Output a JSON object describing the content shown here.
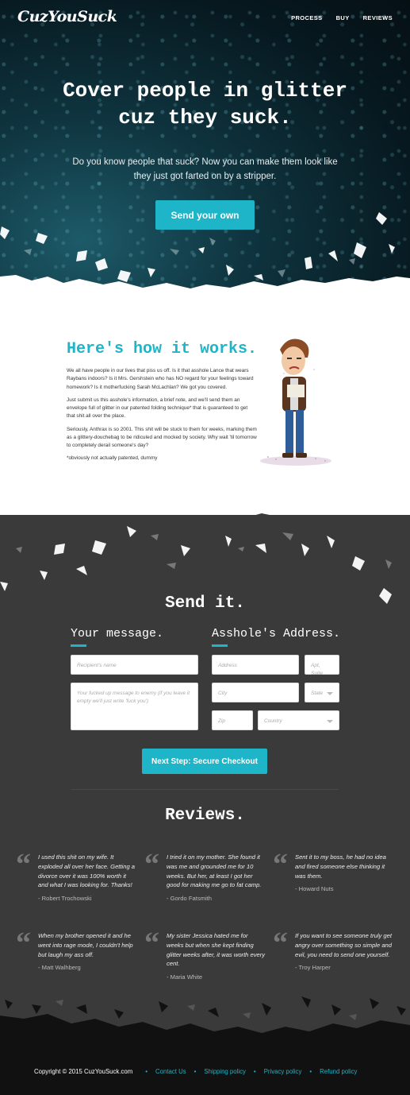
{
  "header": {
    "logo": "CuzYouSuck",
    "nav": [
      "PROCESS",
      "BUY",
      "REVIEWS"
    ]
  },
  "hero": {
    "title_line1": "Cover people in glitter",
    "title_line2": "cuz they suck.",
    "subtitle": "Do you know people that suck? Now you can make them look like they just got farted on by a stripper.",
    "cta": "Send your own"
  },
  "how": {
    "title": "Here's how it works.",
    "p1": "We all have people in our lives that piss us off. Is it that asshole Lance that wears Raybans indoors? Is it Mrs. Gershstein who has NO regard for your feelings toward homework? Is it motherfucking Sarah McLachlan? We got you covered.",
    "p2": "Just submit us this asshole's information, a brief note, and we'll send them an envelope full of glitter in our patented folding technique* that is guaranteed to get that shit all over the place.",
    "p3": "Seriously, Anthrax is so 2001. This shit will be stuck to them for weeks, marking them as a glittery-douchebag to be ridiculed and mocked by society. Why wait 'til tomorrow to completely derail someone's day?",
    "p4": "*obviously not actually patented, dummy"
  },
  "send": {
    "title": "Send it.",
    "message_heading": "Your message.",
    "address_heading": "Asshole's Address.",
    "recipient_placeholder": "Recipient's name",
    "message_placeholder": "Your fucked up message to enemy (if you leave it empty we'll just write 'fuck you')",
    "address_placeholder": "Address",
    "apt_placeholder": "Apt, Suite",
    "city_placeholder": "City",
    "state_placeholder": "State",
    "zip_placeholder": "Zip",
    "country_placeholder": "Country",
    "checkout": "Next Step: Secure Checkout"
  },
  "reviews": {
    "title": "Reviews.",
    "items": [
      {
        "text": "I used this shit on my wife. It exploded all over her face. Getting a divorce over it was 100% worth it and what I was looking for. Thanks!",
        "author": "- Robert Trochowski"
      },
      {
        "text": "I tried it on my mother. She found it was me and grounded me for 10 weeks. But her, at least I got her good for making me go to fat camp.",
        "author": "- Gordo Fatsmith"
      },
      {
        "text": "Sent it to my boss, he had no idea and fired someone else thinking it was them.",
        "author": "- Howard Nuts"
      },
      {
        "text": "When my brother opened it and he went into rage mode, I couldn't help but laugh my ass off.",
        "author": "- Matt Walhberg"
      },
      {
        "text": "My sister Jessica hated me for weeks but when she kept finding glitter weeks after, it was worth every cent.",
        "author": "- Maria White"
      },
      {
        "text": "If you want to see someone truly get angry over something so simple and evil, you need to send one yourself.",
        "author": "- Troy Harper"
      }
    ]
  },
  "footer": {
    "copyright": "Copyright © 2015 CuzYouSuck.com",
    "links": [
      "Contact Us",
      "Shipping policy",
      "Privacy policy",
      "Refund policy"
    ]
  },
  "colors": {
    "accent": "#1fb5c9",
    "dark": "#3a3a3a",
    "footer": "#111111"
  }
}
